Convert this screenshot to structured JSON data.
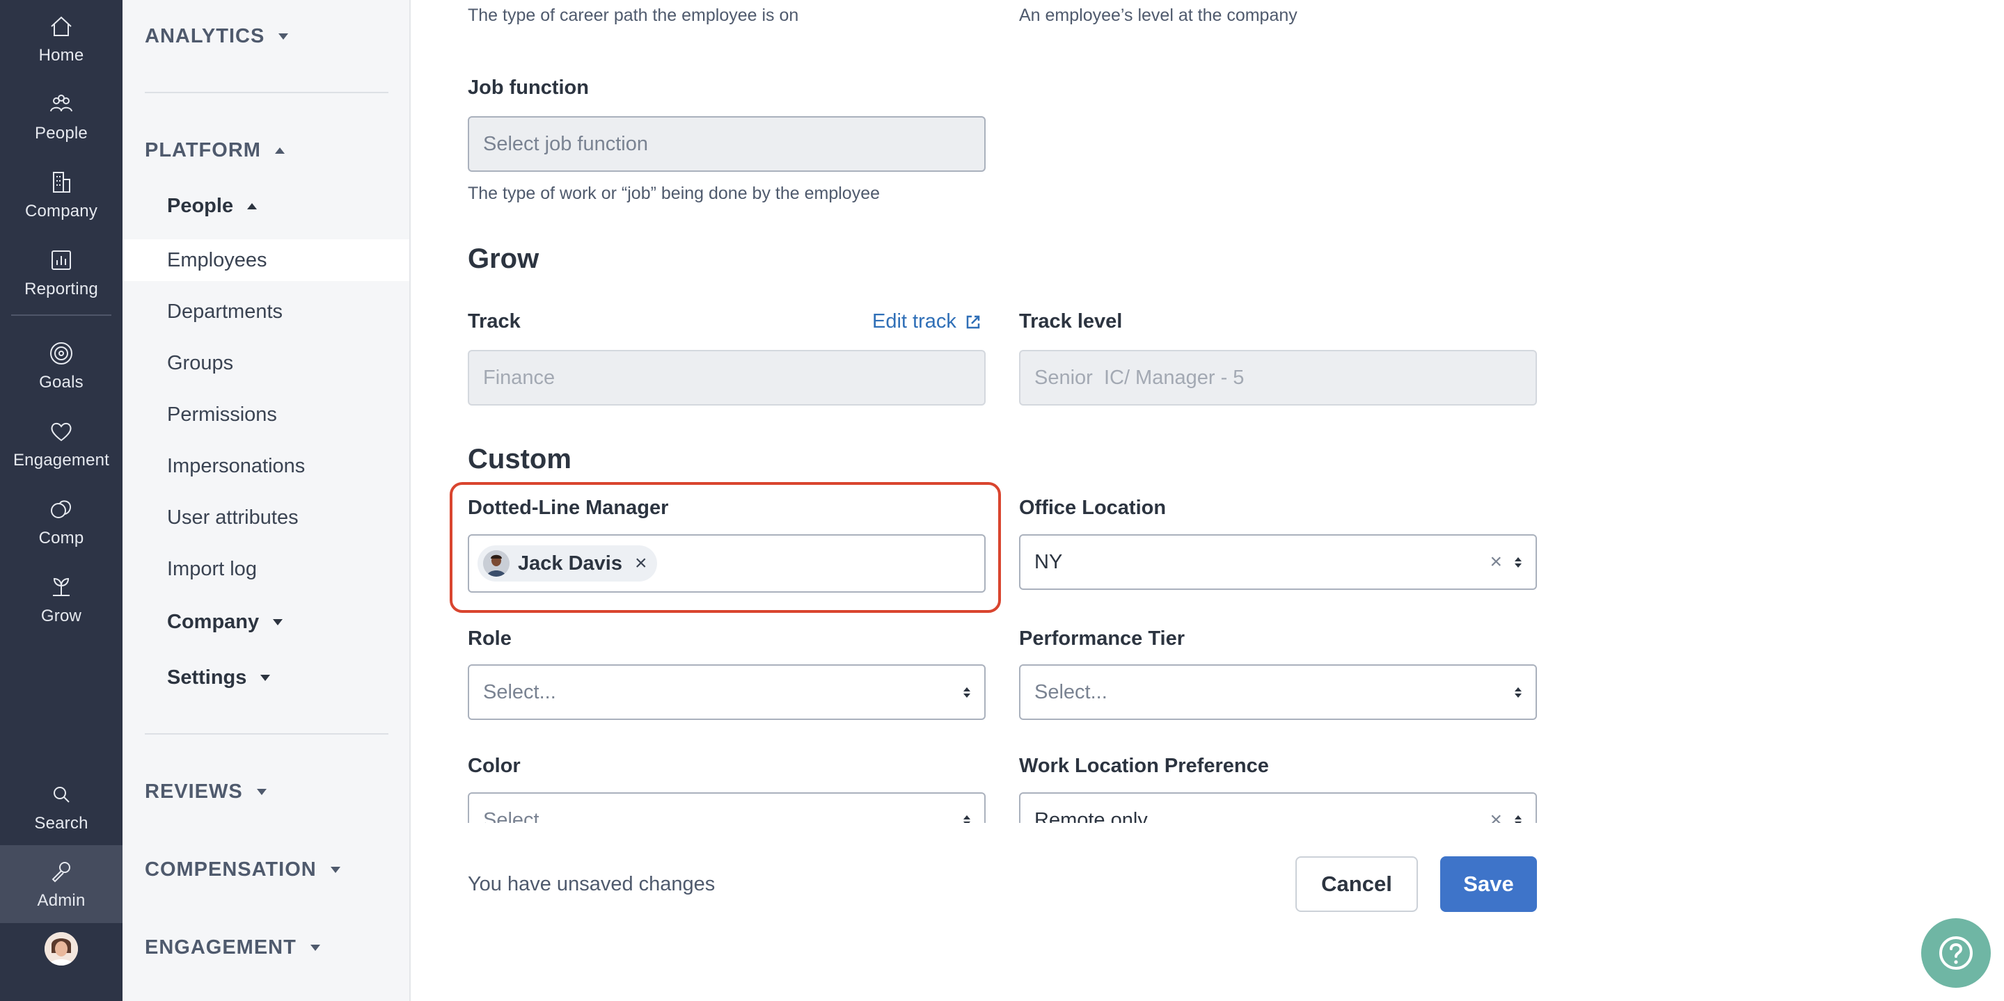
{
  "rail": {
    "items": [
      {
        "label": "Home",
        "icon": "home-icon"
      },
      {
        "label": "People",
        "icon": "people-icon"
      },
      {
        "label": "Company",
        "icon": "building-icon"
      },
      {
        "label": "Reporting",
        "icon": "bar-chart-icon"
      },
      {
        "label": "Goals",
        "icon": "target-icon"
      },
      {
        "label": "Engagement",
        "icon": "heart-icon"
      },
      {
        "label": "Comp",
        "icon": "coins-icon"
      },
      {
        "label": "Grow",
        "icon": "sprout-icon"
      },
      {
        "label": "Search",
        "icon": "search-icon"
      },
      {
        "label": "Admin",
        "icon": "wrench-icon"
      }
    ],
    "active": "Admin"
  },
  "subnav": {
    "analytics": "ANALYTICS",
    "platform": "PLATFORM",
    "people_group": "People",
    "items": [
      "Employees",
      "Departments",
      "Groups",
      "Permissions",
      "Impersonations",
      "User attributes",
      "Import log"
    ],
    "active_item": "Employees",
    "company_group": "Company",
    "settings_group": "Settings",
    "reviews": "REVIEWS",
    "compensation": "COMPENSATION",
    "engagement": "ENGAGEMENT"
  },
  "form": {
    "career_help": "The type of career path the employee is on",
    "level_help": "An employee’s level at the company",
    "job_function": {
      "label": "Job function",
      "placeholder": "Select job function",
      "help": "The type of work or “job” being done by the employee"
    },
    "grow": {
      "title": "Grow",
      "track_label": "Track",
      "edit_track": "Edit track",
      "track_value": "Finance",
      "track_level_label": "Track level",
      "track_level_value": "Senior  IC/ Manager - 5"
    },
    "custom": {
      "title": "Custom",
      "dotted_line_label": "Dotted-Line Manager",
      "dotted_line_value": "Jack Davis",
      "office_label": "Office Location",
      "office_value": "NY",
      "role_label": "Role",
      "role_placeholder": "Select...",
      "performance_label": "Performance Tier",
      "performance_placeholder": "Select...",
      "color_label": "Color",
      "color_placeholder": "Select...",
      "work_location_label": "Work Location Preference",
      "work_location_value": "Remote only"
    }
  },
  "footer": {
    "unsaved": "You have unsaved changes",
    "cancel": "Cancel",
    "save": "Save"
  },
  "colors": {
    "rail_bg": "#2d3446",
    "accent": "#3e74c9",
    "highlight": "#d9452f",
    "help_fab": "#6fb6a4"
  }
}
